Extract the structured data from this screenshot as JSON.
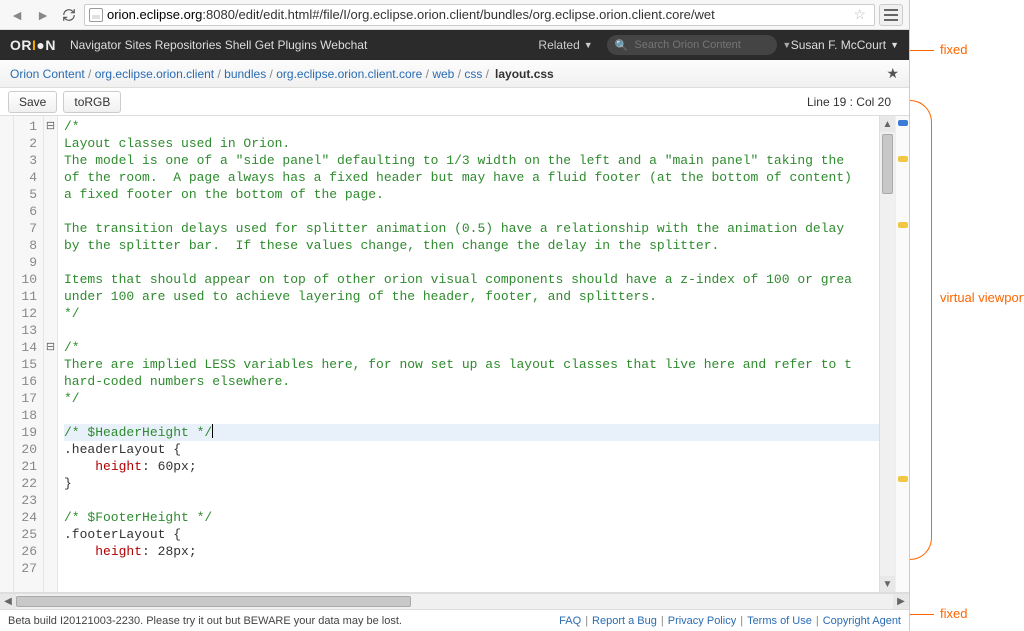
{
  "browser": {
    "url_prefix": "orion.eclipse.org",
    "url_rest": ":8080/edit/edit.html#/file/I/org.eclipse.orion.client/bundles/org.eclipse.orion.client.core/wet"
  },
  "orion_nav": {
    "items": [
      "Navigator",
      "Sites",
      "Repositories",
      "Shell",
      "Get Plugins",
      "Webchat"
    ],
    "related": "Related",
    "search_placeholder": "Search Orion Content",
    "user": "Susan F. McCourt"
  },
  "breadcrumb": {
    "items": [
      "Orion Content",
      "org.eclipse.orion.client",
      "bundles",
      "org.eclipse.orion.client.core",
      "web",
      "css"
    ],
    "current": "layout.css"
  },
  "toolbar": {
    "save": "Save",
    "torgb": "toRGB",
    "cursor": "Line 19 : Col 20"
  },
  "editor": {
    "lines": [
      {
        "n": 1,
        "fold": "⊟",
        "cls": "cm-comment",
        "text": "/*"
      },
      {
        "n": 2,
        "cls": "cm-comment",
        "text": "Layout classes used in Orion."
      },
      {
        "n": 3,
        "cls": "cm-comment",
        "text": "The model is one of a \"side panel\" defaulting to 1/3 width on the left and a \"main panel\" taking the "
      },
      {
        "n": 4,
        "cls": "cm-comment",
        "text": "of the room.  A page always has a fixed header but may have a fluid footer (at the bottom of content)"
      },
      {
        "n": 5,
        "cls": "cm-comment",
        "text": "a fixed footer on the bottom of the page."
      },
      {
        "n": 6,
        "cls": "cm-comment",
        "text": ""
      },
      {
        "n": 7,
        "cls": "cm-comment",
        "text": "The transition delays used for splitter animation (0.5) have a relationship with the animation delay "
      },
      {
        "n": 8,
        "cls": "cm-comment",
        "text": "by the splitter bar.  If these values change, then change the delay in the splitter."
      },
      {
        "n": 9,
        "cls": "cm-comment",
        "text": ""
      },
      {
        "n": 10,
        "cls": "cm-comment",
        "text": "Items that should appear on top of other orion visual components should have a z-index of 100 or grea"
      },
      {
        "n": 11,
        "cls": "cm-comment",
        "text": "under 100 are used to achieve layering of the header, footer, and splitters."
      },
      {
        "n": 12,
        "cls": "cm-comment",
        "text": "*/"
      },
      {
        "n": 13,
        "cls": "",
        "text": ""
      },
      {
        "n": 14,
        "fold": "⊟",
        "cls": "cm-comment",
        "text": "/*"
      },
      {
        "n": 15,
        "cls": "cm-comment",
        "text": "There are implied LESS variables here, for now set up as layout classes that live here and refer to t"
      },
      {
        "n": 16,
        "cls": "cm-comment",
        "text": "hard-coded numbers elsewhere."
      },
      {
        "n": 17,
        "cls": "cm-comment",
        "text": "*/"
      },
      {
        "n": 18,
        "cls": "",
        "text": ""
      },
      {
        "n": 19,
        "cls": "cm-comment",
        "current": true,
        "text": "/* $HeaderHeight */",
        "caret": true
      },
      {
        "n": 20,
        "css": {
          "sel": ".headerLayout",
          "open": true
        }
      },
      {
        "n": 21,
        "css": {
          "indent": "    ",
          "prop": "height",
          "val": "60px"
        }
      },
      {
        "n": 22,
        "css": {
          "close": true
        }
      },
      {
        "n": 23,
        "cls": "",
        "text": ""
      },
      {
        "n": 24,
        "cls": "cm-comment",
        "text": "/* $FooterHeight */"
      },
      {
        "n": 25,
        "css": {
          "sel": ".footerLayout",
          "open": true
        }
      },
      {
        "n": 26,
        "css": {
          "indent": "    ",
          "prop": "height",
          "val": "28px"
        }
      },
      {
        "n": 27,
        "css": {
          "close_partial": true
        }
      }
    ]
  },
  "footer": {
    "build": "Beta build I20121003-2230. Please try it out but BEWARE your data may be lost.",
    "links": [
      "FAQ",
      "Report a Bug",
      "Privacy Policy",
      "Terms of Use",
      "Copyright Agent"
    ]
  },
  "annotations": {
    "fixed_top": "fixed",
    "virtual": "virtual viewport",
    "fixed_bottom": "fixed"
  }
}
